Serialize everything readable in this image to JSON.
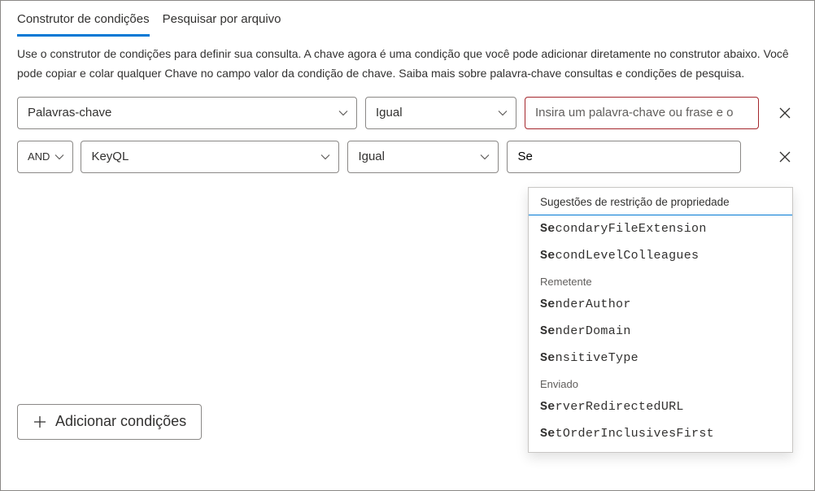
{
  "tabs": {
    "builder": "Construtor de condições",
    "search": "Pesquisar por arquivo"
  },
  "description": "Use o construtor de condições para definir sua consulta. A chave agora é uma condição que você pode adicionar diretamente no construtor abaixo. Você pode copiar e colar qualquer Chave no campo valor da condição de chave. Saiba mais sobre palavra-chave consultas e condições de pesquisa.",
  "row1": {
    "field": "Palavras-chave",
    "operator": "Igual",
    "value_placeholder": "Insira um palavra-chave ou frase e o"
  },
  "row2": {
    "join": "AND",
    "field": "KeyQL",
    "operator": "Igual",
    "value": "Se"
  },
  "dropdown": {
    "header": "Sugestões de restrição de propriedade",
    "prefix": "Se",
    "items_a": [
      "condaryFileExtension",
      "condLevelColleagues"
    ],
    "group_b": "Remetente",
    "items_b": [
      "nderAuthor",
      "nderDomain",
      "nsitiveType"
    ],
    "group_c": "Enviado",
    "items_c": [
      "rverRedirectedURL",
      "tOrderInclusivesFirst"
    ]
  },
  "add_button": "Adicionar condições"
}
